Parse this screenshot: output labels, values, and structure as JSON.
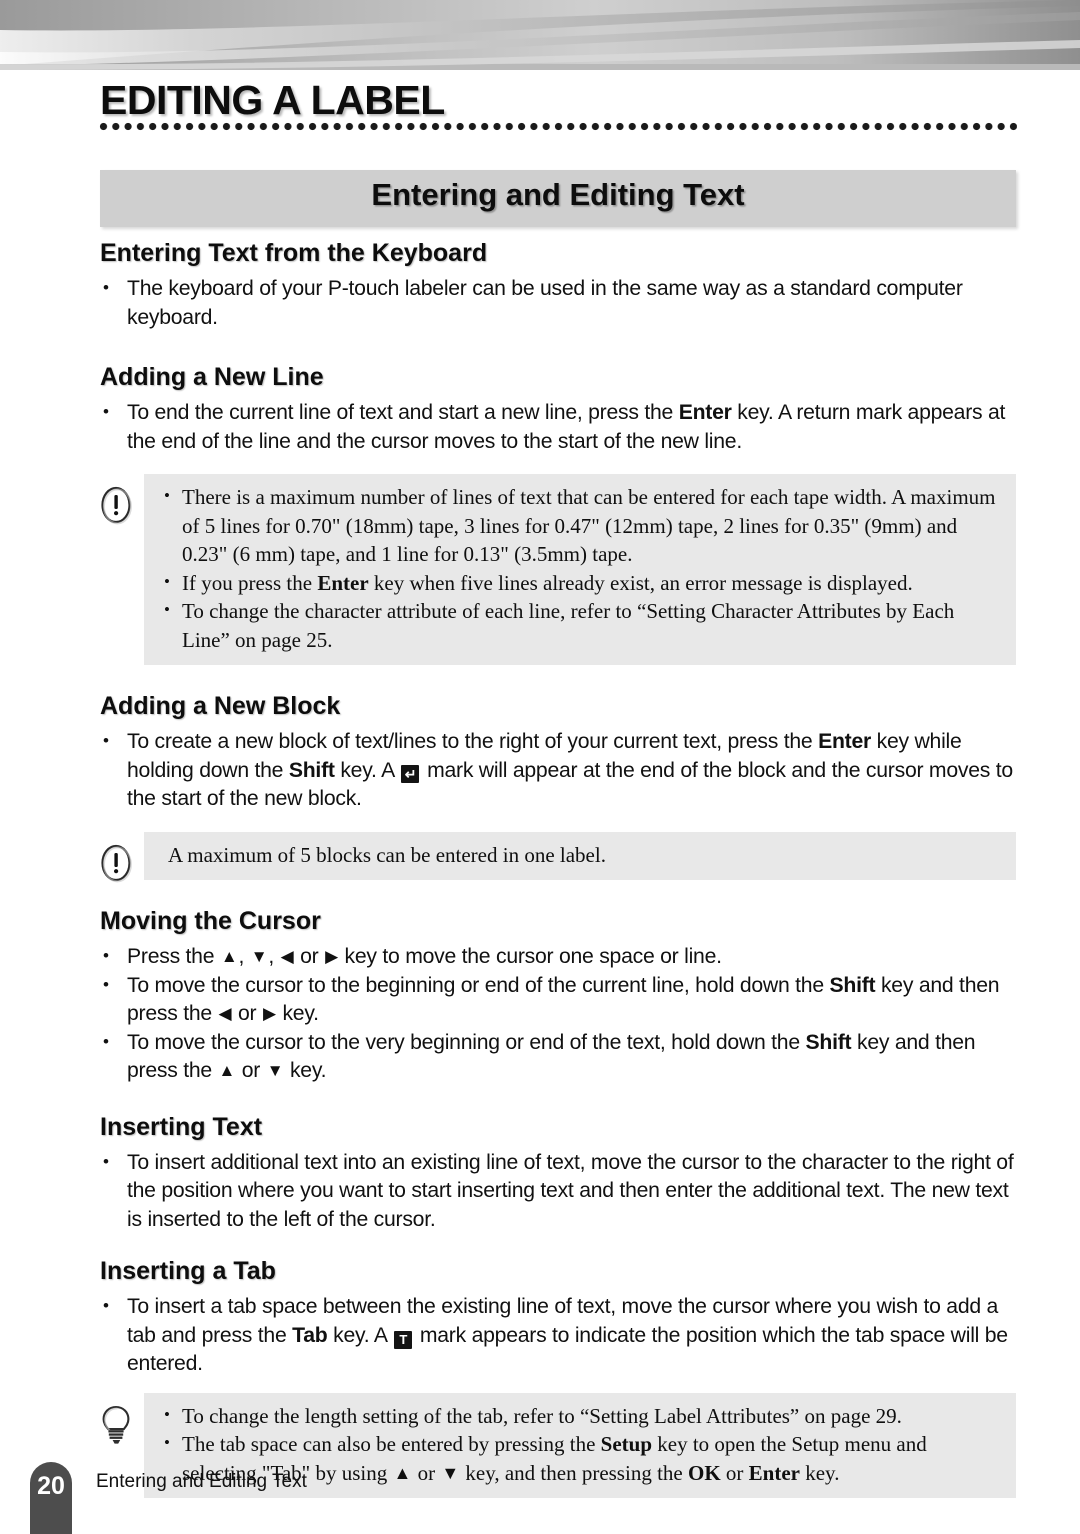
{
  "chapter": {
    "title": "EDITING A LABEL"
  },
  "section": {
    "band_title": "Entering and Editing Text"
  },
  "headings": {
    "entering_text_keyboard": "Entering Text from the Keyboard",
    "adding_new_line": "Adding a New Line",
    "adding_new_block": "Adding a New Block",
    "moving_cursor": "Moving the Cursor",
    "inserting_text": "Inserting Text",
    "inserting_tab": "Inserting a Tab"
  },
  "body": {
    "keyboard_bullet": "The keyboard of your P-touch labeler can be used in the same way as a standard computer keyboard.",
    "new_line_bullet_pre": "To end the current line of text and start a new line, press the ",
    "new_line_bullet_key": "Enter",
    "new_line_bullet_post": " key. A return mark appears at the end of the line and the cursor moves to the start of the new line.",
    "new_block_pre": "To create a new block of text/lines to the right of your current text, press the ",
    "new_block_key1": "Enter",
    "new_block_mid": " key while holding down the ",
    "new_block_key2": "Shift",
    "new_block_mid2": " key. A ",
    "new_block_post": " mark will appear at the end of the block and the cursor moves to the start of the new block.",
    "cursor_b1_pre": "Press the ",
    "cursor_b1_post": " key to move the cursor one space or line.",
    "cursor_b2_pre": "To move the cursor to the beginning or end of the current line, hold down the ",
    "cursor_b2_key": "Shift",
    "cursor_b2_mid": " key and then press the ",
    "cursor_b2_post": " key.",
    "cursor_b3_pre": "To move the cursor to the very beginning or end of the text, hold down the ",
    "cursor_b3_key": "Shift",
    "cursor_b3_mid": " key and then press the ",
    "cursor_b3_post": " key.",
    "inserting_text_bullet": "To insert additional text into an existing line of text, move the cursor to the character to the right of the position where you want to start inserting text and then enter the additional text. The new text is inserted to the left of the cursor.",
    "inserting_tab_pre": "To insert a tab space between the existing line of text, move the cursor where you wish to add a tab and press the ",
    "inserting_tab_key": "Tab",
    "inserting_tab_mid": " key. A ",
    "inserting_tab_post": " mark appears to indicate the position which the tab space will be entered."
  },
  "notes": {
    "line_note": {
      "icon": "warning-icon",
      "items_part1": "There is a maximum number of lines of text that can be entered for each tape width. A maximum of 5 lines for 0.70\" (18mm) tape, 3 lines for 0.47\" (12mm) tape, 2 lines for 0.35\" (9mm) and 0.23\" (6 mm) tape, and 1 line for 0.13\" (3.5mm) tape.",
      "item2_pre": "If you press the ",
      "item2_key": "Enter",
      "item2_post": " key when five lines already exist, an error message is displayed.",
      "item3": "To change the character attribute of each line, refer to “Setting Character Attributes by Each Line” on page 25."
    },
    "block_note": {
      "icon": "warning-icon",
      "text": "A maximum of 5 blocks can be entered in one label."
    },
    "tab_note": {
      "icon": "lightbulb-icon",
      "item1": "To change the length setting of the tab, refer to “Setting Label Attributes” on page 29.",
      "item2_pre": "The tab space can also be entered by pressing the ",
      "item2_key": "Setup",
      "item2_mid": " key to open the Setup menu and selecting \"Tab\" by using ",
      "item2_mid2": " or ",
      "item2_mid3": " key, and then pressing the ",
      "item2_key2": "OK",
      "item2_mid4": " or ",
      "item2_key3": "Enter",
      "item2_post": " key."
    }
  },
  "marks": {
    "block_mark": "↵",
    "tab_mark": "T",
    "arrow_up": "▲",
    "arrow_down": "▼",
    "arrow_left": "◀",
    "arrow_right": "▶",
    "comma": ", ",
    "or": " or "
  },
  "footer": {
    "page_number": "20",
    "caption": "Entering and Editing Text"
  },
  "colors": {
    "band_bg": "#cfcfcf",
    "note_bg": "#e8e8e8",
    "footer_tab": "#4d4d4d"
  }
}
